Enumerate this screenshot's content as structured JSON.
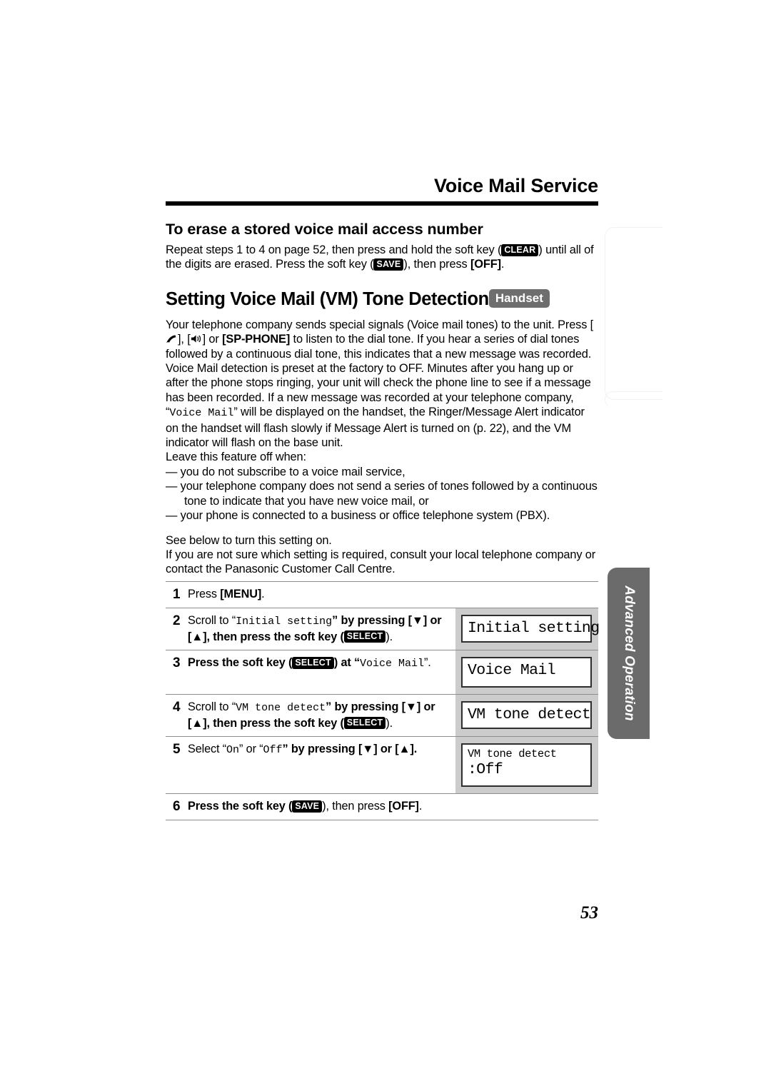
{
  "header": {
    "running_title": "Voice Mail Service"
  },
  "sections": {
    "erase": {
      "heading": "To erase a stored voice mail access number",
      "para_1a": "Repeat steps 1 to 4 on page 52, then press and hold the soft key (",
      "softkey_clear": "CLEAR",
      "para_1b": ") until all of the digits are erased. Press the soft key (",
      "softkey_save": "SAVE",
      "para_1c": "), then press ",
      "key_off": "[OFF]",
      "para_1d": "."
    },
    "setting": {
      "heading": "Setting Voice Mail (VM) Tone Detection",
      "badge": "Handset",
      "p1_a": "Your telephone company sends special signals (Voice mail tones) to the unit. Press [",
      "icon_talk": "telephone-handset-icon",
      "p1_b": "], [",
      "icon_speaker": "speaker-icon",
      "p1_c": "] or ",
      "key_spphone": "[SP-PHONE]",
      "p1_d": " to listen to the dial tone. If you hear a series of dial tones followed by a continuous dial tone, this indicates that a new message was recorded. Voice Mail detection is preset at the factory to OFF. Minutes after you hang up or after the phone stops ringing, your unit will check the phone line to see if a message has been recorded. If a new message was recorded at your telephone company, “",
      "p1_disp": "Voice Mail",
      "p1_e": "” will be displayed on the handset, the Ringer/Message Alert indicator on the handset will flash slowly if Message Alert is turned on (p. 22), and the VM indicator will flash on the base unit.",
      "leave_off_intro": "Leave this feature off when:",
      "bullets": [
        "— you do not subscribe to a voice mail service,",
        "— your telephone company does not send a series of tones followed by a continuous tone to indicate that you have new voice mail, or",
        "— your phone is connected to a business or office telephone system (PBX)."
      ],
      "see_below": "See below to turn this setting on.",
      "not_sure": "If you are not sure which setting is required, consult your local telephone company or contact the Panasonic Customer Call Centre."
    }
  },
  "steps": [
    {
      "number": "1",
      "text_a": "Press ",
      "key": "[MENU]",
      "text_b": ".",
      "lcd": null
    },
    {
      "number": "2",
      "text_a": "Scroll to “",
      "disp": "Initial setting",
      "text_b": "” by pressing [▼] or [▲], then press the soft key (",
      "softkey": "SELECT",
      "text_c": ").",
      "lcd": {
        "line1": "Initial setting",
        "line2": null
      }
    },
    {
      "number": "3",
      "text_a": "Press the soft key (",
      "softkey": "SELECT",
      "text_b": ") at “",
      "disp": "Voice Mail",
      "text_c": "”.",
      "lcd": {
        "line1": "Voice Mail",
        "line2": null
      }
    },
    {
      "number": "4",
      "text_a": "Scroll to “",
      "disp": "VM tone detect",
      "text_b": "” by pressing [▼] or [▲], then press the soft key (",
      "softkey": "SELECT",
      "text_c": ").",
      "lcd": {
        "line1": "VM tone detect",
        "line2": null
      }
    },
    {
      "number": "5",
      "text_a": "Select “",
      "disp_on": "On",
      "text_b": "” or “",
      "disp_off": "Off",
      "text_c": "” by pressing [▼] or [▲].",
      "lcd": {
        "line1": "VM tone detect",
        "line2": ":Off"
      }
    },
    {
      "number": "6",
      "text_a": "Press the soft key (",
      "softkey": "SAVE",
      "text_b": "), then press ",
      "key": "[OFF]",
      "text_c": ".",
      "lcd": null
    }
  ],
  "side_tab": {
    "label": "Advanced Operation"
  },
  "folio": {
    "page_number": "53"
  },
  "colors": {
    "tab_gray": "#6b6b6b",
    "badge_gray": "#6e6e6e",
    "column_gray": "#cccccc",
    "rule_black": "#000000"
  }
}
